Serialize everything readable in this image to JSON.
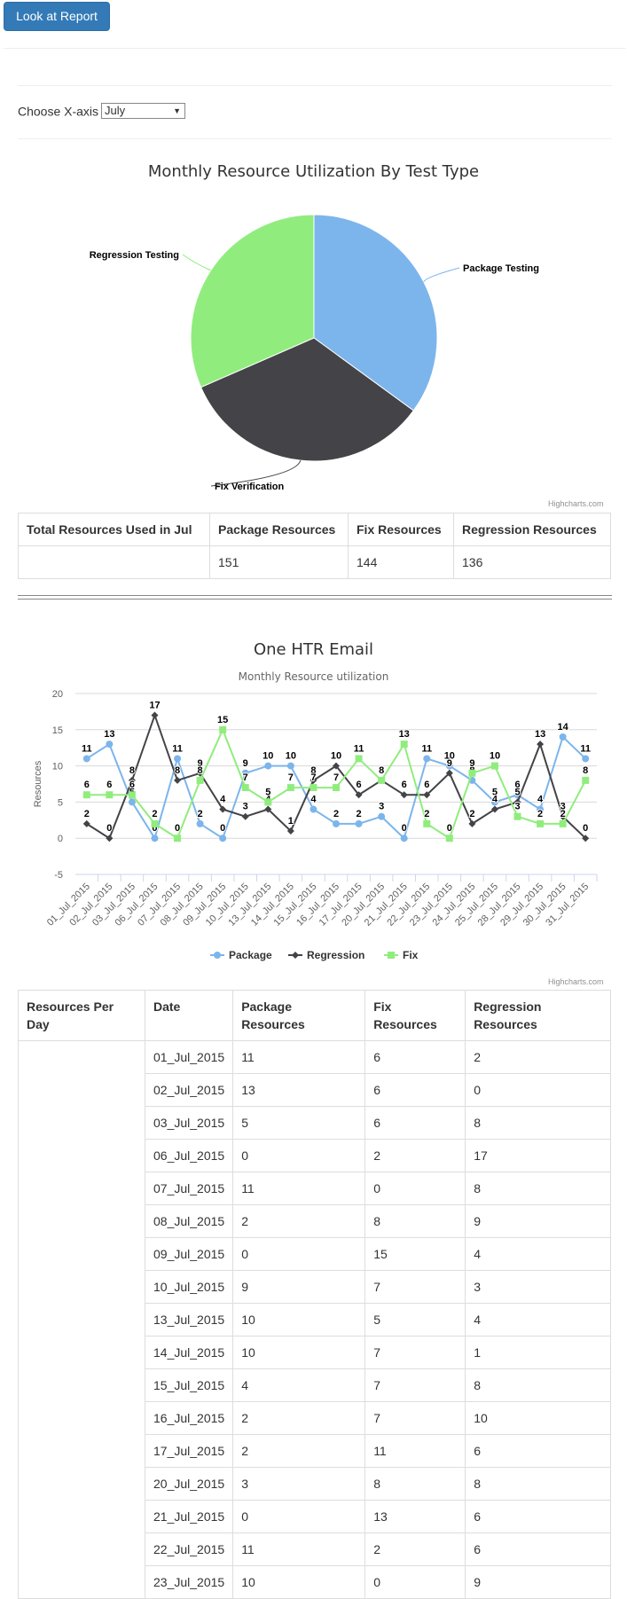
{
  "toolbar": {
    "report_button": "Look at Report"
  },
  "xaxis_chooser": {
    "label": "Choose X-axis",
    "selected": "July"
  },
  "pie_chart": {
    "title": "Monthly Resource Utilization By Test Type",
    "credits": "Highcharts.com",
    "colors": {
      "Package Testing": "#7cb5ec",
      "Fix Verification": "#434348",
      "Regression Testing": "#90ed7d"
    }
  },
  "summary_table": {
    "headers": [
      "Total Resources Used in Jul",
      "Package Resources",
      "Fix Resources",
      "Regression Resources"
    ],
    "row": [
      "",
      "151",
      "144",
      "136"
    ]
  },
  "line_chart": {
    "title": "One HTR Email",
    "subtitle": "Monthly Resource utilization",
    "credits": "Highcharts.com",
    "colors": {
      "Package": "#7cb5ec",
      "Regression": "#434348",
      "Fix": "#90ed7d"
    }
  },
  "daily_table": {
    "headers": [
      "Resources Per Day",
      "Date",
      "Package Resources",
      "Fix Resources",
      "Regression Resources"
    ],
    "rows": [
      [
        "01_Jul_2015",
        "11",
        "6",
        "2"
      ],
      [
        "02_Jul_2015",
        "13",
        "6",
        "0"
      ],
      [
        "03_Jul_2015",
        "5",
        "6",
        "8"
      ],
      [
        "06_Jul_2015",
        "0",
        "2",
        "17"
      ],
      [
        "07_Jul_2015",
        "11",
        "0",
        "8"
      ],
      [
        "08_Jul_2015",
        "2",
        "8",
        "9"
      ],
      [
        "09_Jul_2015",
        "0",
        "15",
        "4"
      ],
      [
        "10_Jul_2015",
        "9",
        "7",
        "3"
      ],
      [
        "13_Jul_2015",
        "10",
        "5",
        "4"
      ],
      [
        "14_Jul_2015",
        "10",
        "7",
        "1"
      ],
      [
        "15_Jul_2015",
        "4",
        "7",
        "8"
      ],
      [
        "16_Jul_2015",
        "2",
        "7",
        "10"
      ],
      [
        "17_Jul_2015",
        "2",
        "11",
        "6"
      ],
      [
        "20_Jul_2015",
        "3",
        "8",
        "8"
      ],
      [
        "21_Jul_2015",
        "0",
        "13",
        "6"
      ],
      [
        "22_Jul_2015",
        "11",
        "2",
        "6"
      ],
      [
        "23_Jul_2015",
        "10",
        "0",
        "9"
      ]
    ]
  },
  "chart_data": [
    {
      "type": "pie",
      "title": "Monthly Resource Utilization By Test Type",
      "labels": [
        "Package Testing",
        "Fix Verification",
        "Regression Testing"
      ],
      "values": [
        151,
        144,
        136
      ]
    },
    {
      "type": "line",
      "title": "One HTR Email",
      "subtitle": "Monthly Resource utilization",
      "ylabel": "Resources",
      "ylim": [
        -5,
        20
      ],
      "yticks": [
        -5,
        0,
        5,
        10,
        15,
        20
      ],
      "grid": true,
      "legend": "bottom",
      "x": [
        "01_Jul_2015",
        "02_Jul_2015",
        "03_Jul_2015",
        "06_Jul_2015",
        "07_Jul_2015",
        "08_Jul_2015",
        "09_Jul_2015",
        "10_Jul_2015",
        "13_Jul_2015",
        "14_Jul_2015",
        "15_Jul_2015",
        "16_Jul_2015",
        "17_Jul_2015",
        "20_Jul_2015",
        "21_Jul_2015",
        "22_Jul_2015",
        "23_Jul_2015",
        "24_Jul_2015",
        "25_Jul_2015",
        "28_Jul_2015",
        "29_Jul_2015",
        "30_Jul_2015",
        "31_Jul_2015"
      ],
      "series": [
        {
          "name": "Package",
          "values": [
            11,
            13,
            5,
            0,
            11,
            2,
            0,
            9,
            10,
            10,
            4,
            2,
            2,
            3,
            0,
            11,
            10,
            8,
            5,
            6,
            4,
            14,
            11
          ]
        },
        {
          "name": "Regression",
          "values": [
            2,
            0,
            8,
            17,
            8,
            9,
            4,
            3,
            4,
            1,
            8,
            10,
            6,
            8,
            6,
            6,
            9,
            2,
            4,
            5,
            13,
            3,
            0
          ]
        },
        {
          "name": "Fix",
          "values": [
            6,
            6,
            6,
            2,
            0,
            8,
            15,
            7,
            5,
            7,
            7,
            7,
            11,
            8,
            13,
            2,
            0,
            9,
            10,
            3,
            2,
            2,
            8
          ]
        }
      ]
    }
  ]
}
